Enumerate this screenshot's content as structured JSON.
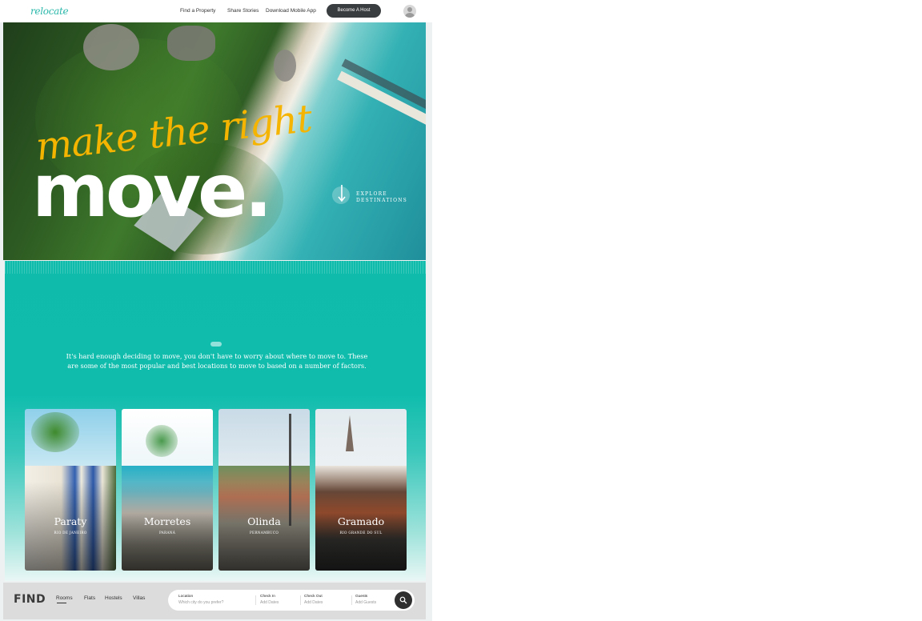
{
  "header": {
    "logo": "relocate",
    "nav": [
      "Find a Property",
      "Share Stories",
      "Download Mobile App"
    ],
    "host_button": "Become A Host"
  },
  "hero": {
    "script_line": "make the right",
    "big_line": "move.",
    "explore_line1": "EXPLORE",
    "explore_line2": "DESTINATIONS"
  },
  "intro": {
    "line1": "It's hard enough deciding to move, you don't have to worry about where to move to. These",
    "line2": "are some of the most popular and best locations to move to based on a  number of factors."
  },
  "destinations": [
    {
      "name": "Paraty",
      "region": "RIO DE JANEIRO"
    },
    {
      "name": "Morretes",
      "region": "PARANÁ"
    },
    {
      "name": "Olinda",
      "region": "PERNAMBUCO"
    },
    {
      "name": "Gramado",
      "region": "RIO GRANDE DO SUL"
    }
  ],
  "find": {
    "title": "FIND",
    "tabs": [
      "Rooms",
      "Flats",
      "Hostels",
      "Villas"
    ],
    "active_tab": "Rooms",
    "fields": [
      {
        "label": "Location",
        "placeholder": "Which city do you prefer?"
      },
      {
        "label": "Check In",
        "placeholder": "Add Dates"
      },
      {
        "label": "Check Out",
        "placeholder": "Add Dates"
      },
      {
        "label": "Guests",
        "placeholder": "Add Guests"
      }
    ]
  },
  "colors": {
    "accent_teal": "#10bdad",
    "script_yellow": "#f4b400",
    "host_button_bg": "#3a3d3f"
  }
}
